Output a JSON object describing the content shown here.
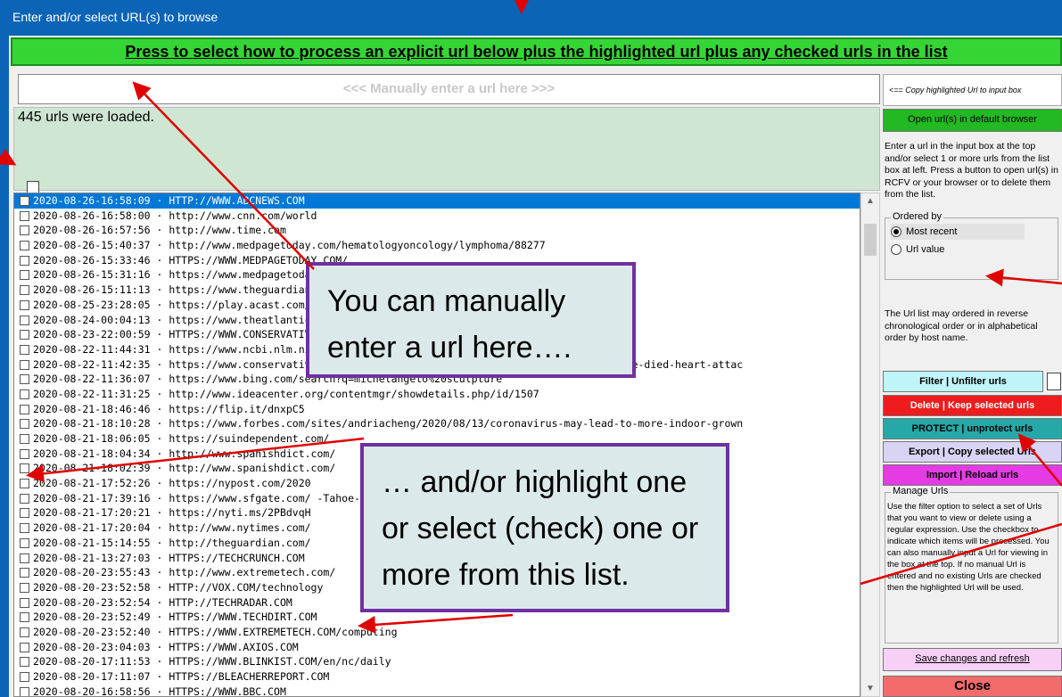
{
  "window_title": "Enter and/or select URL(s) to browse",
  "header_button": "Press to select how to process an explicit url below plus the highlighted url plus any checked urls in the list",
  "url_input_placeholder": "<<< Manually enter a url here >>>",
  "loaded_text": "445 urls were loaded.",
  "rows": [
    "2020-08-26-16:58:09 · HTTP://WWW.ABCNEWS.COM",
    "2020-08-26-16:58:00 · http://www.cnn.com/world",
    "2020-08-26-16:57:56 · http://www.time.com",
    "2020-08-26-15:40:37 · http://www.medpagetoday.com/hematologyoncology/lymphoma/88277",
    "2020-08-26-15:33:46 · HTTPS://WWW.MEDPAGETODAY.COM/",
    "2020-08-26-15:31:16 · https://www.medpagetoday.com/                                              20-08-",
    "2020-08-26-15:11:13 · https://www.theguardian.com/                                               P=Shar",
    "2020-08-25-23:28:05 · https://play.acast.com/",
    "2020-08-24-00:04:13 · https://www.theatlantic.com/                                               -19-ev",
    "2020-08-23-22:00:59 · HTTPS://WWW.CONSERVATIVEREVIEW.COM/",
    "2020-08-22-11:44:31 · https://www.ncbi.nlm.nih.gov/",
    "2020-08-22-11:42:35 · https://www.conservativereview.com/news/horowitz-study-2-weeks-denver-people-died-heart-attac",
    "2020-08-22-11:36:07 · https://www.bing.com/search?q=michelangelo%20sculpture",
    "2020-08-22-11:31:25 · http://www.ideacenter.org/contentmgr/showdetails.php/id/1507",
    "2020-08-21-18:46:46 · https://flip.it/dnxpC5",
    "2020-08-21-18:10:28 · https://www.forbes.com/sites/andriacheng/2020/08/13/coronavirus-may-lead-to-more-indoor-grown",
    "2020-08-21-18:06:05 · https://suindependent.com/",
    "2020-08-21-18:04:34 · http://www.spanishdict.com/",
    "2020-08-21-18:02:39 · http://www.spanishdict.com/",
    "2020-08-21-17:52:26 · https://nypost.com/2020",
    "2020-08-21-17:39:16 · https://www.sfgate.com/                                                   -Tahoe-",
    "2020-08-21-17:20:21 · https://nyti.ms/2PBdvqH",
    "2020-08-21-17:20:04 · http://www.nytimes.com/",
    "2020-08-21-15:14:55 · http://theguardian.com/",
    "2020-08-21-13:27:03 · HTTPS://TECHCRUNCH.COM",
    "2020-08-20-23:55:43 · http://www.extremetech.com/",
    "2020-08-20-23:52:58 · HTTP://VOX.COM/technology",
    "2020-08-20-23:52:54 · HTTP://TECHRADAR.COM",
    "2020-08-20-23:52:49 · HTTPS://WWW.TECHDIRT.COM",
    "2020-08-20-23:52:40 · HTTPS://WWW.EXTREMETECH.COM/computing",
    "2020-08-20-23:04:03 · HTTPS://WWW.AXIOS.COM",
    "2020-08-20-17:11:53 · HTTPS://WWW.BLINKIST.COM/en/nc/daily",
    "2020-08-20-17:11:07 · HTTPS://BLEACHERREPORT.COM",
    "2020-08-20-16:58:56 · HTTPS://WWW.BBC.COM"
  ],
  "copy_button": "<== Copy highlighted Url to input box",
  "open_button": "Open url(s) in default browser",
  "help1": "Enter a url in the input box at the top and/or select 1 or more urls from the list box at left. Press a button to open url(s) in RCFV or your browser or to delete them from the list.",
  "ordered_by": {
    "title": "Ordered by",
    "options": [
      "Most recent",
      "Url value"
    ]
  },
  "help2": "The Url list may ordered in reverse chronological order or in alphabetical order by host name.",
  "filter_button": "Filter | Unfilter urls",
  "delete_button": "Delete | Keep selected urls",
  "protect_button": "PROTECT | unprotect urls",
  "export_button": "Export | Copy selected Urls",
  "import_button": "Import | Reload urls",
  "manage": {
    "title": "Manage Urls",
    "text": "Use the filter option to select a set of Urls that you want to view or delete using a regular expression. Use the checkbox to indicate which items will be processed. You can also manually input a Url for viewing in the box at the top. If no manual Url is entered and no existing Urls are checked then the highlighted Url will be used."
  },
  "save_button": "Save changes and refresh",
  "close_button": "Close",
  "callout1": "You can manually enter a url here….",
  "callout2": "… and/or highlight one or select (check) one or more from this list.",
  "colors": {
    "title_blue": "#0b64b6",
    "header_green": "#36d536",
    "selection_blue": "#0078d7",
    "callout_border": "#7030a0",
    "arrow_red": "#e00000"
  }
}
